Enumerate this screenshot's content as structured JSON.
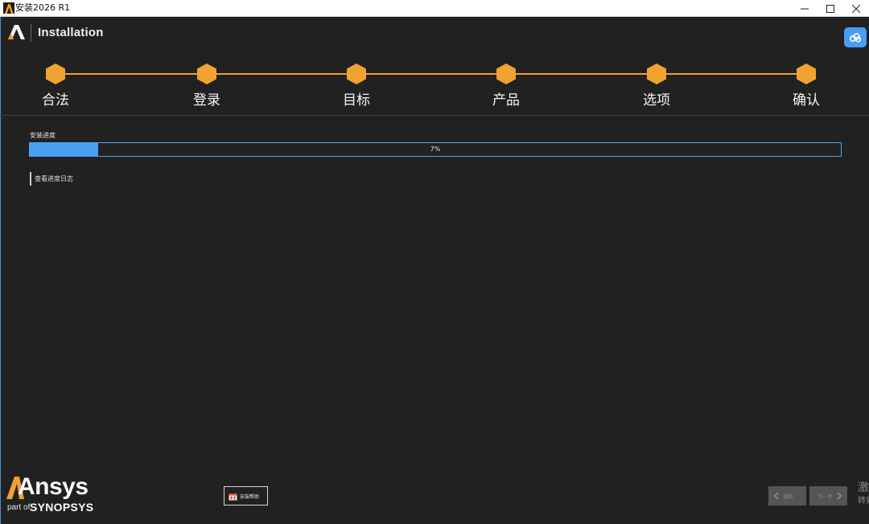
{
  "window": {
    "title": "安装2026 R1",
    "controls": {
      "minimize_icon": "minimize-icon",
      "maximize_icon": "maximize-icon",
      "close_icon": "close-icon"
    }
  },
  "header": {
    "title": "Installation",
    "cloud_icon": "cloud-icon"
  },
  "steps": [
    {
      "label": "合法"
    },
    {
      "label": "登录"
    },
    {
      "label": "目标"
    },
    {
      "label": "产品"
    },
    {
      "label": "选项"
    },
    {
      "label": "确认"
    }
  ],
  "progress": {
    "label": "安装进度",
    "percent": 7,
    "percent_text": "7%",
    "view_log_label": "查看进度日志"
  },
  "footer": {
    "brand_name": "Ansys",
    "brand_part_of": "part of",
    "brand_parent": "SYNOPSYS",
    "help_label": "安装帮助",
    "back_label": "返回",
    "next_label": "下一步"
  },
  "watermark": {
    "line1": "激活 Windows",
    "line2": "转到"
  },
  "colors": {
    "background": "#212121",
    "accent_orange": "#f0a331",
    "accent_blue": "#4a9ff4"
  }
}
